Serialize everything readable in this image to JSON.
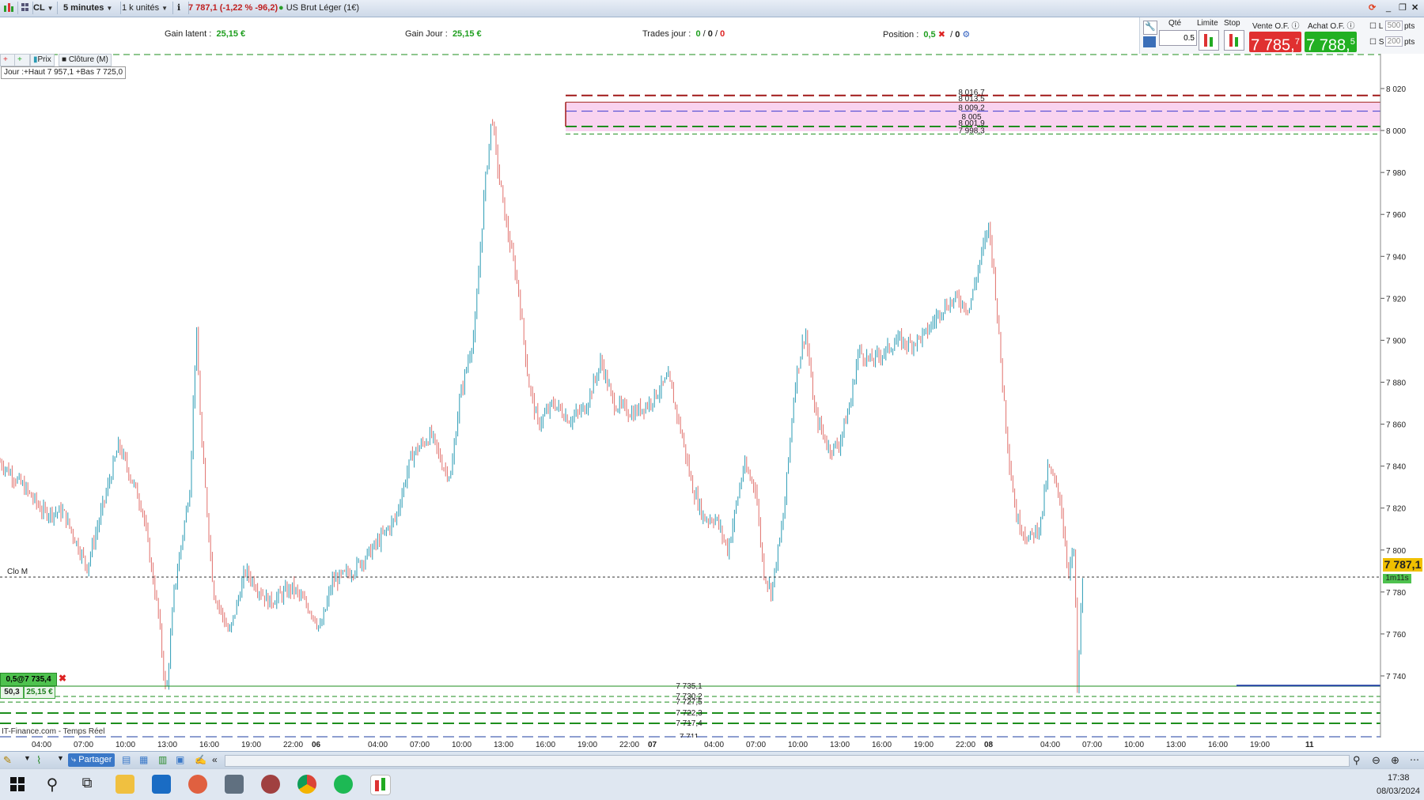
{
  "toolbar": {
    "symbol": "CL",
    "timeframe": "5 minutes",
    "units": "1 k unités",
    "quote": "7 787,1 (-1,22 % -96,2)",
    "instrument": "US Brut Léger (1€)"
  },
  "info": {
    "gain_latent_label": "Gain latent :",
    "gain_latent_value": "25,15 €",
    "gain_jour_label": "Gain Jour :",
    "gain_jour_value": "25,15 €",
    "trades_label": "Trades jour :",
    "trades_v1": "0",
    "trades_v2": "0",
    "trades_v3": "0",
    "position_label": "Position :",
    "position_value": "0,5",
    "position_zero": "0"
  },
  "order": {
    "qty_label": "Qté",
    "qty_value": "0.5",
    "limit_label": "Limite",
    "stop_label": "Stop",
    "sell_label": "Vente O.F.",
    "buy_label": "Achat O.F.",
    "sell_price_main": "7 785,",
    "sell_price_sup": "7",
    "buy_price_main": "7 788,",
    "buy_price_sup": "5",
    "l_label": "L",
    "s_label": "S",
    "l_pts": "500",
    "s_pts": "200",
    "pts": "pts"
  },
  "indicator_toolbar": {
    "prix": "Prix",
    "cloture": "Clôture (M)",
    "jour": "Jour :+Haut 7 957,1 +Bas 7 725,0"
  },
  "chart_data": {
    "type": "candlestick",
    "y_axis_ticks": [
      "8 020",
      "8 000",
      "7 980",
      "7 960",
      "7 940",
      "7 920",
      "7 900",
      "7 880",
      "7 860",
      "7 840",
      "7 820",
      "7 800",
      "7 780",
      "7 760",
      "7 740"
    ],
    "y_tick_values": [
      8020,
      8000,
      7980,
      7960,
      7940,
      7920,
      7900,
      7880,
      7860,
      7840,
      7820,
      7800,
      7780,
      7760,
      7740
    ],
    "ylim": [
      7711,
      8040
    ],
    "x_axis_ticks": [
      "04:00",
      "07:00",
      "10:00",
      "13:00",
      "16:00",
      "19:00",
      "22:00",
      "06",
      "04:00",
      "07:00",
      "10:00",
      "13:00",
      "16:00",
      "19:00",
      "22:00",
      "07",
      "04:00",
      "07:00",
      "10:00",
      "13:00",
      "16:00",
      "19:00",
      "22:00",
      "08",
      "04:00",
      "07:00",
      "10:00",
      "13:00",
      "16:00",
      "19:00",
      "11"
    ],
    "close_line_label": "Clo M",
    "close_line_value": 7787.1,
    "last_price": "7 787,1",
    "timer": "1m11s",
    "upper_levels": [
      {
        "value": 8016.7,
        "label": "8 016,7",
        "color": "#a01818",
        "style": "dash"
      },
      {
        "value": 8013.5,
        "label": "8 013,5",
        "color": "#a01818",
        "style": "solid"
      },
      {
        "value": 8009.2,
        "label": "8 009,2",
        "color": "#3a3ad0",
        "style": "dash"
      },
      {
        "value": 8005,
        "label": "8 005",
        "color": "#e060c0",
        "style": "none"
      },
      {
        "value": 8001.9,
        "label": "8 001,9",
        "color": "#1e8e1e",
        "style": "dash"
      },
      {
        "value": 7998.3,
        "label": "7 998,3",
        "color": "#1e8e1e",
        "style": "dashthin"
      }
    ],
    "lower_levels": [
      {
        "value": 7735.1,
        "label": "7 735,1",
        "color": "#1e8e1e",
        "style": "solidthin"
      },
      {
        "value": 7730.2,
        "label": "7 730,2",
        "color": "#1e8e1e",
        "style": "dashthin"
      },
      {
        "value": 7727.5,
        "label": "7 727,5",
        "color": "#1e8e1e",
        "style": "dashthin"
      },
      {
        "value": 7722.3,
        "label": "7 722,3",
        "color": "#1e8e1e",
        "style": "dash"
      },
      {
        "value": 7717.4,
        "label": "7 717,4",
        "color": "#1e8e1e",
        "style": "dash"
      },
      {
        "value": 7711,
        "label": "7 711",
        "color": "#1e3ea0",
        "style": "dash"
      }
    ],
    "position_tag": "0,5@7 735,4",
    "position_tag_qty": "50,3",
    "position_tag_gain": "25,15 €",
    "waypoints": [
      [
        0,
        7842
      ],
      [
        30,
        7830
      ],
      [
        55,
        7818
      ],
      [
        80,
        7818
      ],
      [
        110,
        7792
      ],
      [
        150,
        7850
      ],
      [
        180,
        7820
      ],
      [
        200,
        7770
      ],
      [
        210,
        7730
      ],
      [
        220,
        7780
      ],
      [
        240,
        7830
      ],
      [
        248,
        7905
      ],
      [
        255,
        7850
      ],
      [
        270,
        7780
      ],
      [
        290,
        7760
      ],
      [
        310,
        7790
      ],
      [
        340,
        7775
      ],
      [
        370,
        7782
      ],
      [
        395,
        7770
      ],
      [
        405,
        7762
      ],
      [
        420,
        7785
      ],
      [
        445,
        7790
      ],
      [
        470,
        7800
      ],
      [
        500,
        7815
      ],
      [
        520,
        7845
      ],
      [
        545,
        7855
      ],
      [
        560,
        7840
      ],
      [
        570,
        7835
      ],
      [
        580,
        7870
      ],
      [
        600,
        7905
      ],
      [
        612,
        7970
      ],
      [
        622,
        8008
      ],
      [
        628,
        7985
      ],
      [
        640,
        7955
      ],
      [
        655,
        7925
      ],
      [
        668,
        7880
      ],
      [
        680,
        7860
      ],
      [
        700,
        7870
      ],
      [
        720,
        7862
      ],
      [
        740,
        7868
      ],
      [
        760,
        7890
      ],
      [
        775,
        7870
      ],
      [
        800,
        7865
      ],
      [
        820,
        7870
      ],
      [
        845,
        7882
      ],
      [
        860,
        7858
      ],
      [
        875,
        7830
      ],
      [
        890,
        7815
      ],
      [
        905,
        7815
      ],
      [
        920,
        7800
      ],
      [
        940,
        7840
      ],
      [
        955,
        7830
      ],
      [
        965,
        7790
      ],
      [
        975,
        7780
      ],
      [
        990,
        7815
      ],
      [
        1005,
        7880
      ],
      [
        1018,
        7905
      ],
      [
        1030,
        7865
      ],
      [
        1048,
        7848
      ],
      [
        1060,
        7850
      ],
      [
        1075,
        7870
      ],
      [
        1085,
        7895
      ],
      [
        1100,
        7890
      ],
      [
        1120,
        7895
      ],
      [
        1135,
        7900
      ],
      [
        1150,
        7898
      ],
      [
        1170,
        7903
      ],
      [
        1190,
        7915
      ],
      [
        1210,
        7920
      ],
      [
        1225,
        7915
      ],
      [
        1240,
        7940
      ],
      [
        1250,
        7955
      ],
      [
        1258,
        7925
      ],
      [
        1265,
        7890
      ],
      [
        1275,
        7845
      ],
      [
        1285,
        7815
      ],
      [
        1300,
        7805
      ],
      [
        1315,
        7812
      ],
      [
        1325,
        7840
      ],
      [
        1340,
        7825
      ],
      [
        1350,
        7790
      ],
      [
        1358,
        7800
      ],
      [
        1362,
        7730
      ],
      [
        1366,
        7770
      ],
      [
        1369,
        7790
      ]
    ]
  },
  "footer": {
    "source": "IT-Finance.com - Temps Réel",
    "partager": "Partager",
    "time": "17:38",
    "date": "08/03/2024"
  },
  "colors": {
    "up": "#2a9bb4",
    "down": "#e0706c",
    "price_tag": "#f0c000",
    "sell": "#e03030",
    "buy": "#22b022"
  }
}
